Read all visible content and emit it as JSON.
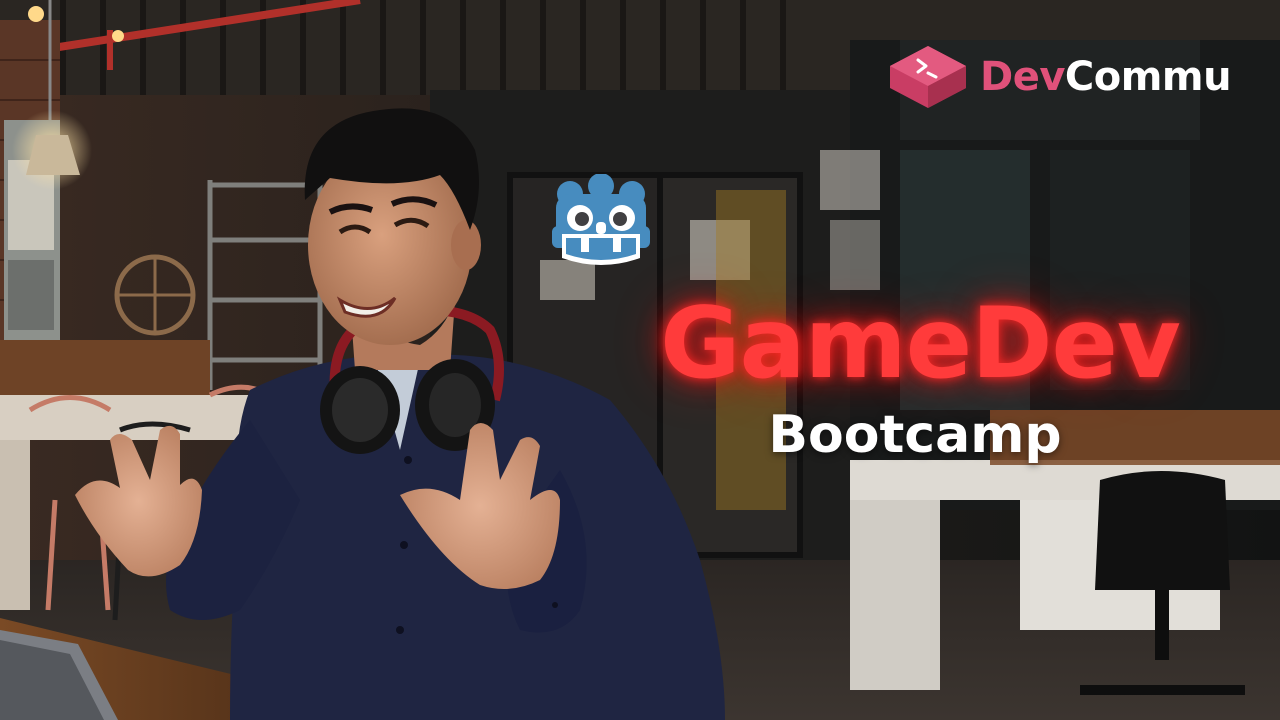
{
  "brand": {
    "name_part1": "Dev",
    "name_part2": "Commu",
    "icon": "pink-keycap-terminal-icon",
    "accent_color": "#e0517a"
  },
  "headline": {
    "title": "GameDev",
    "subtitle": "Bootcamp",
    "title_color": "#ff3b3b",
    "subtitle_color": "#ffffff"
  },
  "godot_icon": "godot-engine-robot-icon",
  "scene": {
    "background": "dimly lit industrial coworking space",
    "subject": "smiling presenter in navy shirt with headphones around neck"
  }
}
